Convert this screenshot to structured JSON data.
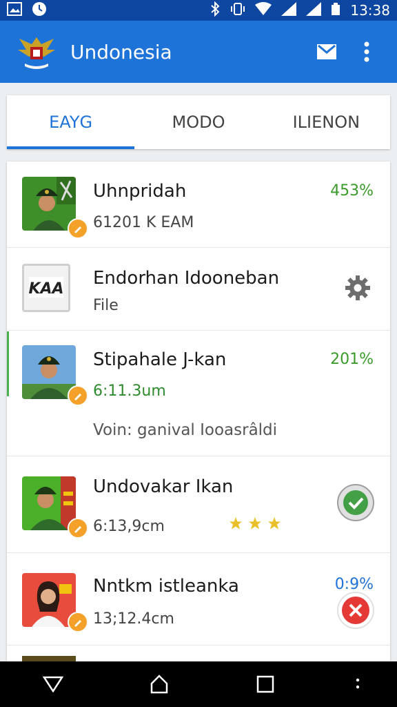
{
  "status_bar": {
    "time": "13:38",
    "icons": [
      "gallery-icon",
      "clock-icon",
      "bluetooth-icon",
      "vibrate-icon",
      "wifi-icon",
      "signal-icon",
      "signal-icon",
      "battery-icon"
    ]
  },
  "app_bar": {
    "title": "Undonesia",
    "logo": "garuda-emblem",
    "actions": [
      "mail-icon",
      "more-vert-icon"
    ],
    "color": "#1e73d8"
  },
  "tabs": [
    {
      "label": "EAYG",
      "active": true
    },
    {
      "label": "MODO",
      "active": false
    },
    {
      "label": "ILIENON",
      "active": false
    }
  ],
  "list": [
    {
      "title": "Uhnpridah",
      "subtitle": "61201 K EAM",
      "right": "453%",
      "thumb": "soldier-avatar"
    },
    {
      "title": "Endorhan Idooneban",
      "subtitle": "File",
      "right_icon": "gear-icon",
      "thumb": "kaa-logo",
      "thumb_text": "KAA"
    },
    {
      "title": "Stipahale J-kan",
      "subtitle": "6:11.3um",
      "right": "201%",
      "extra": "Voin: ganival Iooasrâldi",
      "thumb": "soldier-avatar"
    },
    {
      "title": "Undovakar Ikan",
      "subtitle": "6:13,9cm",
      "right_icon": "check-circle-icon",
      "stars": 3,
      "thumb": "soldier-avatar"
    },
    {
      "title": "Nntkm istleanka",
      "subtitle": "13;12.4cm",
      "right": "0:9%",
      "right_icon": "cancel-fab-icon",
      "thumb": "woman-avatar"
    }
  ],
  "nav": [
    "back-icon",
    "home-icon",
    "recents-icon",
    "more-icon"
  ]
}
